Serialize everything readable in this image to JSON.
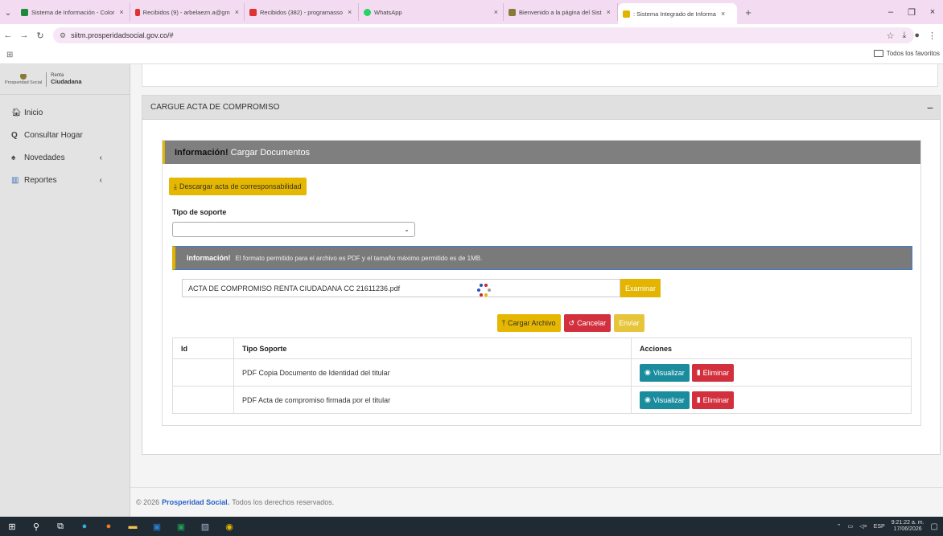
{
  "browser": {
    "tabs": [
      {
        "label": "Sistema de Información - Color",
        "color": "#1d8a3a"
      },
      {
        "label": "Recibidos (9) - arbelaezn.a@gm",
        "color": "#d33"
      },
      {
        "label": "Recibidos (382) - programasso",
        "color": "#d33"
      },
      {
        "label": "WhatsApp",
        "color": "#25d366"
      },
      {
        "label": "Bienvenido a la página del Sist",
        "color": "#8a7a3a"
      },
      {
        "label": ": Sistema Integrado de Informa",
        "color": "#e0b400"
      }
    ],
    "new_tab": "+",
    "url": "siitm.prosperidadsocial.gov.co/#",
    "bookmarks_all": "Todos los favoritos"
  },
  "sidebar": {
    "brand_left": "Prosperidad Social",
    "brand_right_top": "Renta",
    "brand_right_bottom": "Ciudadana",
    "items": [
      {
        "label": "Inicio",
        "icon": "home-icon",
        "glyph": "⌂"
      },
      {
        "label": "Consultar Hogar",
        "icon": "search-icon",
        "glyph": "🔍"
      },
      {
        "label": "Novedades",
        "icon": "bell-icon",
        "glyph": "🔔",
        "chevron": "‹"
      },
      {
        "label": "Reportes",
        "icon": "chart-icon",
        "glyph": "▥",
        "chevron": "‹"
      }
    ]
  },
  "panel": {
    "title": "CARGUE ACTA DE COMPROMISO",
    "collapse": "−"
  },
  "info": {
    "strong": "Información!",
    "text": "Cargar Documentos"
  },
  "download_button": "Descargar acta de corresponsabilidad",
  "tipo_soporte": {
    "label": "Tipo de soporte",
    "value": ""
  },
  "alert": {
    "strong": "Información!",
    "text": "El formato permitido para el archivo es PDF y el tamaño máximo permitido es de 1MB."
  },
  "file": {
    "name": "ACTA DE COMPROMISO RENTA CIUDADANA CC 21611236.pdf",
    "browse": "Examinar"
  },
  "actions": {
    "upload": "Cargar Archivo",
    "cancel": "Cancelar",
    "send": "Enviar"
  },
  "table": {
    "headers": [
      "Id",
      "Tipo Soporte",
      "Acciones"
    ],
    "rows": [
      {
        "id": "",
        "tipo": "PDF Copia Documento de Identidad del titular",
        "view": "Visualizar",
        "delete": "Eliminar"
      },
      {
        "id": "",
        "tipo": "PDF Acta de compromiso firmada por el titular",
        "view": "Visualizar",
        "delete": "Eliminar"
      }
    ]
  },
  "footer": {
    "year": "© 2026",
    "org": "Prosperidad Social.",
    "rights": "Todos los derechos reservados."
  },
  "taskbar": {
    "lang": "ESP",
    "time": "9:21:22 a. m.",
    "date": "17/06/2026"
  },
  "colors": {
    "yellow": "#e5b700",
    "red": "#d3303e",
    "teal": "#1a8c9e",
    "link_blue": "#2a62c9"
  }
}
